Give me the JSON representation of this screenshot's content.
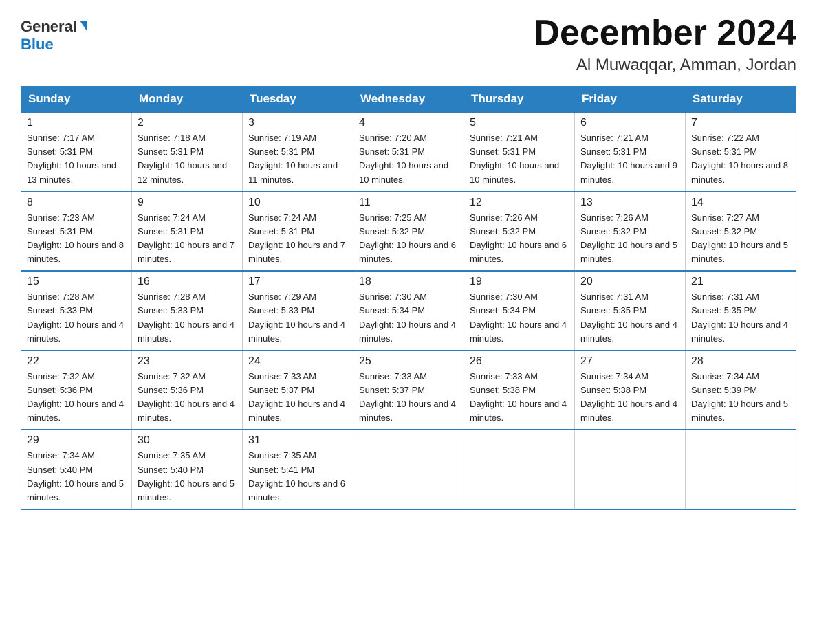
{
  "header": {
    "logo_general": "General",
    "logo_blue": "Blue",
    "month_title": "December 2024",
    "location": "Al Muwaqqar, Amman, Jordan"
  },
  "days_of_week": [
    "Sunday",
    "Monday",
    "Tuesday",
    "Wednesday",
    "Thursday",
    "Friday",
    "Saturday"
  ],
  "weeks": [
    [
      {
        "num": "1",
        "sunrise": "7:17 AM",
        "sunset": "5:31 PM",
        "daylight": "10 hours and 13 minutes."
      },
      {
        "num": "2",
        "sunrise": "7:18 AM",
        "sunset": "5:31 PM",
        "daylight": "10 hours and 12 minutes."
      },
      {
        "num": "3",
        "sunrise": "7:19 AM",
        "sunset": "5:31 PM",
        "daylight": "10 hours and 11 minutes."
      },
      {
        "num": "4",
        "sunrise": "7:20 AM",
        "sunset": "5:31 PM",
        "daylight": "10 hours and 10 minutes."
      },
      {
        "num": "5",
        "sunrise": "7:21 AM",
        "sunset": "5:31 PM",
        "daylight": "10 hours and 10 minutes."
      },
      {
        "num": "6",
        "sunrise": "7:21 AM",
        "sunset": "5:31 PM",
        "daylight": "10 hours and 9 minutes."
      },
      {
        "num": "7",
        "sunrise": "7:22 AM",
        "sunset": "5:31 PM",
        "daylight": "10 hours and 8 minutes."
      }
    ],
    [
      {
        "num": "8",
        "sunrise": "7:23 AM",
        "sunset": "5:31 PM",
        "daylight": "10 hours and 8 minutes."
      },
      {
        "num": "9",
        "sunrise": "7:24 AM",
        "sunset": "5:31 PM",
        "daylight": "10 hours and 7 minutes."
      },
      {
        "num": "10",
        "sunrise": "7:24 AM",
        "sunset": "5:31 PM",
        "daylight": "10 hours and 7 minutes."
      },
      {
        "num": "11",
        "sunrise": "7:25 AM",
        "sunset": "5:32 PM",
        "daylight": "10 hours and 6 minutes."
      },
      {
        "num": "12",
        "sunrise": "7:26 AM",
        "sunset": "5:32 PM",
        "daylight": "10 hours and 6 minutes."
      },
      {
        "num": "13",
        "sunrise": "7:26 AM",
        "sunset": "5:32 PM",
        "daylight": "10 hours and 5 minutes."
      },
      {
        "num": "14",
        "sunrise": "7:27 AM",
        "sunset": "5:32 PM",
        "daylight": "10 hours and 5 minutes."
      }
    ],
    [
      {
        "num": "15",
        "sunrise": "7:28 AM",
        "sunset": "5:33 PM",
        "daylight": "10 hours and 4 minutes."
      },
      {
        "num": "16",
        "sunrise": "7:28 AM",
        "sunset": "5:33 PM",
        "daylight": "10 hours and 4 minutes."
      },
      {
        "num": "17",
        "sunrise": "7:29 AM",
        "sunset": "5:33 PM",
        "daylight": "10 hours and 4 minutes."
      },
      {
        "num": "18",
        "sunrise": "7:30 AM",
        "sunset": "5:34 PM",
        "daylight": "10 hours and 4 minutes."
      },
      {
        "num": "19",
        "sunrise": "7:30 AM",
        "sunset": "5:34 PM",
        "daylight": "10 hours and 4 minutes."
      },
      {
        "num": "20",
        "sunrise": "7:31 AM",
        "sunset": "5:35 PM",
        "daylight": "10 hours and 4 minutes."
      },
      {
        "num": "21",
        "sunrise": "7:31 AM",
        "sunset": "5:35 PM",
        "daylight": "10 hours and 4 minutes."
      }
    ],
    [
      {
        "num": "22",
        "sunrise": "7:32 AM",
        "sunset": "5:36 PM",
        "daylight": "10 hours and 4 minutes."
      },
      {
        "num": "23",
        "sunrise": "7:32 AM",
        "sunset": "5:36 PM",
        "daylight": "10 hours and 4 minutes."
      },
      {
        "num": "24",
        "sunrise": "7:33 AM",
        "sunset": "5:37 PM",
        "daylight": "10 hours and 4 minutes."
      },
      {
        "num": "25",
        "sunrise": "7:33 AM",
        "sunset": "5:37 PM",
        "daylight": "10 hours and 4 minutes."
      },
      {
        "num": "26",
        "sunrise": "7:33 AM",
        "sunset": "5:38 PM",
        "daylight": "10 hours and 4 minutes."
      },
      {
        "num": "27",
        "sunrise": "7:34 AM",
        "sunset": "5:38 PM",
        "daylight": "10 hours and 4 minutes."
      },
      {
        "num": "28",
        "sunrise": "7:34 AM",
        "sunset": "5:39 PM",
        "daylight": "10 hours and 5 minutes."
      }
    ],
    [
      {
        "num": "29",
        "sunrise": "7:34 AM",
        "sunset": "5:40 PM",
        "daylight": "10 hours and 5 minutes."
      },
      {
        "num": "30",
        "sunrise": "7:35 AM",
        "sunset": "5:40 PM",
        "daylight": "10 hours and 5 minutes."
      },
      {
        "num": "31",
        "sunrise": "7:35 AM",
        "sunset": "5:41 PM",
        "daylight": "10 hours and 6 minutes."
      },
      null,
      null,
      null,
      null
    ]
  ],
  "labels": {
    "sunrise": "Sunrise:",
    "sunset": "Sunset:",
    "daylight": "Daylight:"
  }
}
